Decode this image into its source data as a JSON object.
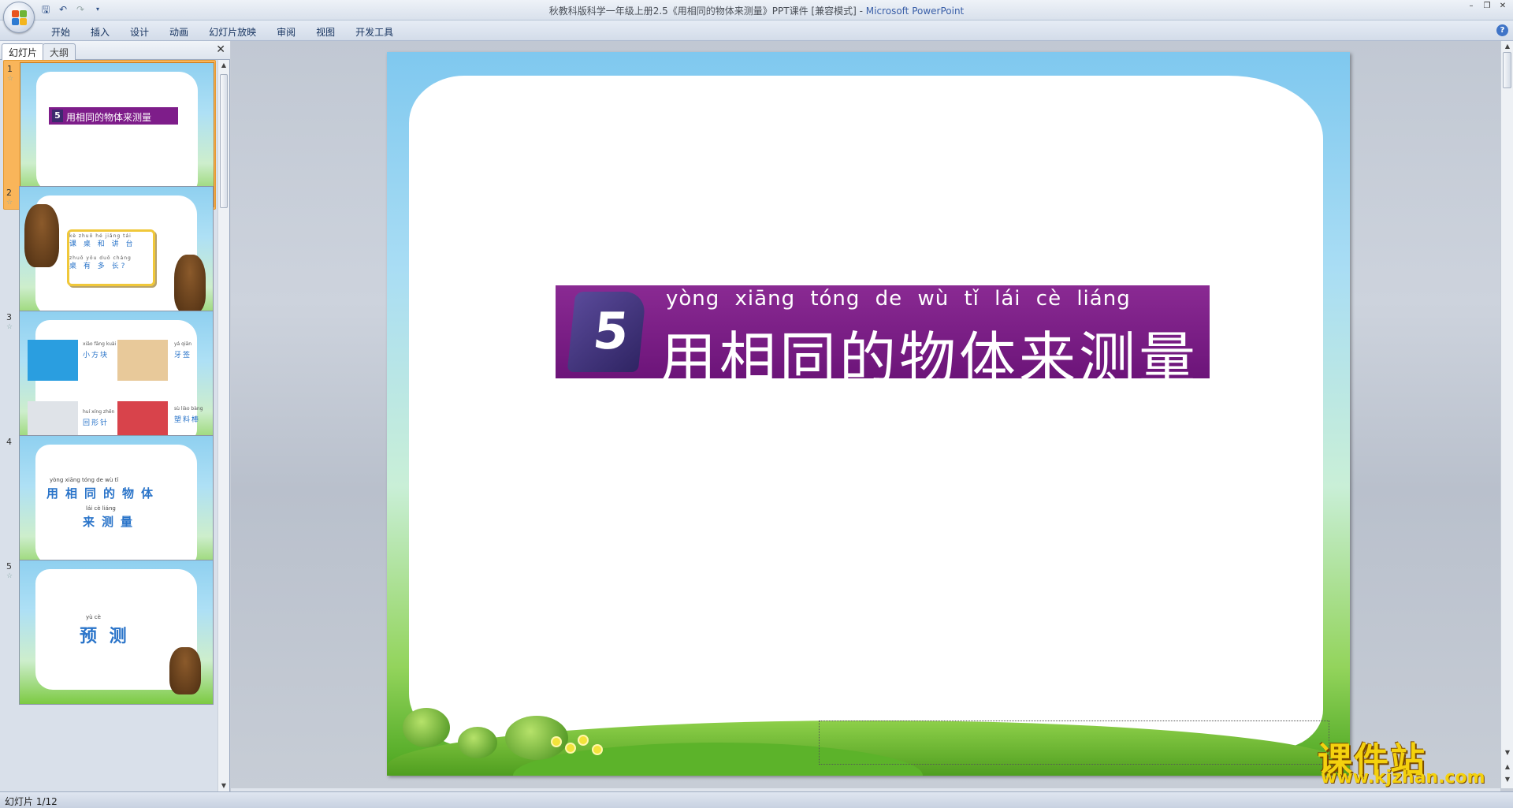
{
  "window": {
    "title": "秋教科版科学一年级上册2.5《用相同的物体来测量》PPT课件 [兼容模式]",
    "separator": " - ",
    "app": "Microsoft PowerPoint"
  },
  "ribbon": {
    "tabs": [
      "开始",
      "插入",
      "设计",
      "动画",
      "幻灯片放映",
      "审阅",
      "视图",
      "开发工具"
    ]
  },
  "panel": {
    "tab_slides": "幻灯片",
    "tab_outline": "大纲"
  },
  "thumbnails": [
    {
      "num": "1",
      "banner_num": "5",
      "banner_text": "用相同的物体来测量"
    },
    {
      "num": "2",
      "lines_py": [
        "kè zhuō hé jiǎng tái",
        "zhuō yǒu duō cháng"
      ],
      "lines": [
        "课 桌 和 讲 台",
        "桌 有 多 长?"
      ]
    },
    {
      "num": "3",
      "items": [
        {
          "py": "xiǎo fāng kuài",
          "label": "小方块"
        },
        {
          "py": "yá qiān",
          "label": "牙签"
        },
        {
          "py": "huí xíng zhēn",
          "label": "回形针"
        },
        {
          "py": "sù liào bàng",
          "label": "塑料棒"
        }
      ]
    },
    {
      "num": "4",
      "py1": "yòng  xiāng  tóng   de     wù     tǐ",
      "line1": "用相同的物体",
      "py2": "lái    cè   liáng",
      "line2": "来测量"
    },
    {
      "num": "5",
      "py": "yù        cè",
      "text": "预    测"
    }
  ],
  "slide": {
    "number": "5",
    "pinyin": "yòng xiāng tóng de wù tǐ lái cè liáng",
    "title": "用相同的物体来测量"
  },
  "status": {
    "slide_indicator": "幻灯片 1/12"
  },
  "watermark": {
    "text": "课件站",
    "url": "www.kjzhan.com"
  }
}
